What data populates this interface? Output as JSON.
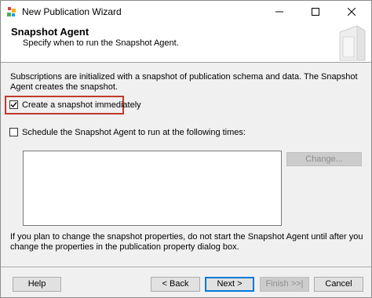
{
  "window": {
    "title": "New Publication Wizard"
  },
  "header": {
    "title": "Snapshot Agent",
    "subtitle": "Specify when to run the Snapshot Agent."
  },
  "body": {
    "intro": "Subscriptions are initialized with a snapshot of publication schema and data. The Snapshot Agent creates the snapshot.",
    "create_snapshot": {
      "label": "Create a snapshot immediately",
      "checked": true
    },
    "schedule": {
      "label": "Schedule the Snapshot Agent to run at the following times:",
      "checked": false
    },
    "change_label": "Change...",
    "note": "If you plan to change the snapshot properties, do not start the Snapshot Agent until after you change the properties in the publication property dialog box."
  },
  "footer": {
    "help": "Help",
    "back": "< Back",
    "next": "Next >",
    "finish": "Finish >>|",
    "cancel": "Cancel"
  },
  "colors": {
    "highlight": "#c0392b",
    "focus": "#0078d7"
  }
}
